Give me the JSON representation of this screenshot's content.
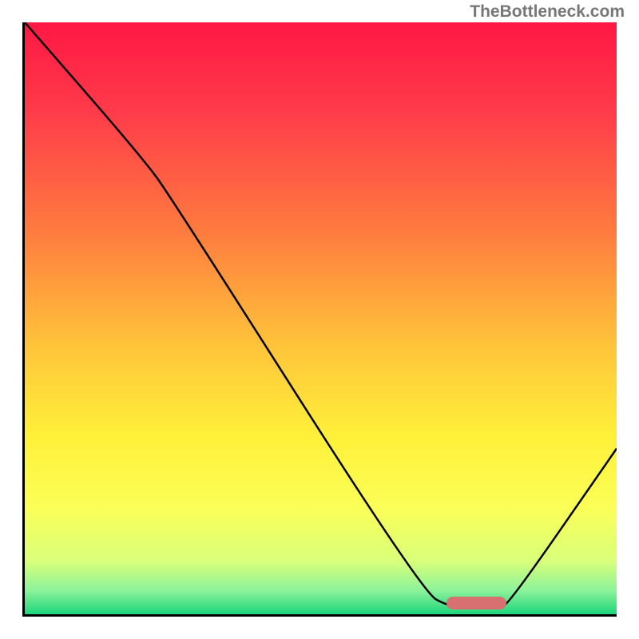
{
  "watermark": "TheBottleneck.com",
  "chart_data": {
    "type": "line",
    "title": "",
    "xlabel": "",
    "ylabel": "",
    "x_range": [
      0,
      100
    ],
    "y_range": [
      0,
      100
    ],
    "gradient_stops": [
      {
        "offset": 0,
        "color": "#ff1744"
      },
      {
        "offset": 15,
        "color": "#ff3b4a"
      },
      {
        "offset": 35,
        "color": "#ff7a3f"
      },
      {
        "offset": 55,
        "color": "#ffc53a"
      },
      {
        "offset": 70,
        "color": "#fff03a"
      },
      {
        "offset": 82,
        "color": "#fbff57"
      },
      {
        "offset": 91,
        "color": "#d9ff7a"
      },
      {
        "offset": 96,
        "color": "#8cf29a"
      },
      {
        "offset": 100,
        "color": "#1dd67a"
      }
    ],
    "curve_points": [
      {
        "x": 0,
        "y": 100
      },
      {
        "x": 20,
        "y": 77
      },
      {
        "x": 25,
        "y": 70
      },
      {
        "x": 67,
        "y": 4
      },
      {
        "x": 72,
        "y": 1
      },
      {
        "x": 80,
        "y": 1
      },
      {
        "x": 82,
        "y": 2
      },
      {
        "x": 100,
        "y": 28
      }
    ],
    "optimal_zone": {
      "x_start": 71,
      "x_end": 81,
      "y": 1.2,
      "height": 2.2
    }
  }
}
